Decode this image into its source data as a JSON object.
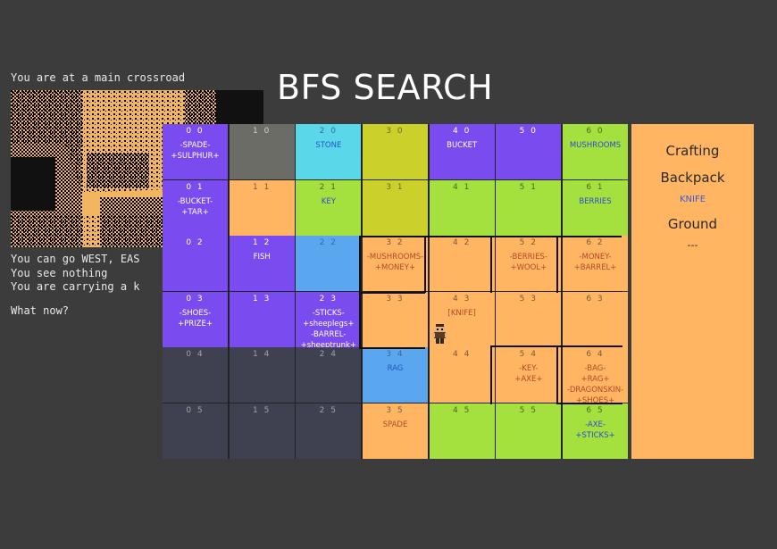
{
  "terminal": {
    "location": "You are at a main crossroad",
    "exits": "You can go WEST, EAS",
    "sees": "You see nothing",
    "carrying": "You are carrying a k",
    "prompt": "What now?"
  },
  "title": "BFS SEARCH",
  "colors": {
    "purple": "#7a4cf0",
    "orange": "#ffb562",
    "green": "#a4e03e",
    "olive": "#cbd02a",
    "cyan": "#5ad8ea",
    "blue": "#5aa7f0",
    "darkslate": "#3f4150",
    "gray": "#6c6c66",
    "wall": "#111111"
  },
  "grid": {
    "cells": [
      {
        "coord": "0 0",
        "lines": [
          "-SPADE-",
          "+SULPHUR+"
        ],
        "color": "purple"
      },
      {
        "coord": "1 0",
        "lines": [],
        "color": "gray"
      },
      {
        "coord": "2 0",
        "lines": [
          "STONE"
        ],
        "color": "cyan"
      },
      {
        "coord": "3 0",
        "lines": [],
        "color": "olive"
      },
      {
        "coord": "4 0",
        "lines": [
          "BUCKET"
        ],
        "color": "purple"
      },
      {
        "coord": "5 0",
        "lines": [],
        "color": "purple"
      },
      {
        "coord": "6 0",
        "lines": [
          "MUSHROOMS"
        ],
        "color": "green"
      },
      {
        "coord": "0 1",
        "lines": [
          "-BUCKET-",
          "+TAR+"
        ],
        "color": "purple"
      },
      {
        "coord": "1 1",
        "lines": [],
        "color": "orange"
      },
      {
        "coord": "2 1",
        "lines": [
          "KEY"
        ],
        "color": "green"
      },
      {
        "coord": "3 1",
        "lines": [],
        "color": "olive"
      },
      {
        "coord": "4 1",
        "lines": [],
        "color": "green"
      },
      {
        "coord": "5 1",
        "lines": [],
        "color": "green"
      },
      {
        "coord": "6 1",
        "lines": [
          "BERRIES"
        ],
        "color": "green"
      },
      {
        "coord": "0 2",
        "lines": [],
        "color": "purple"
      },
      {
        "coord": "1 2",
        "lines": [
          "FISH"
        ],
        "color": "purple"
      },
      {
        "coord": "2 2",
        "lines": [],
        "color": "blue"
      },
      {
        "coord": "3 2",
        "lines": [
          "-MUSHROOMS-",
          "+MONEY+"
        ],
        "color": "orange"
      },
      {
        "coord": "4 2",
        "lines": [],
        "color": "orange"
      },
      {
        "coord": "5 2",
        "lines": [
          "-BERRIES-",
          "+WOOL+"
        ],
        "color": "orange"
      },
      {
        "coord": "6 2",
        "lines": [
          "-MONEY-",
          "+BARREL+"
        ],
        "color": "orange"
      },
      {
        "coord": "0 3",
        "lines": [
          "-SHOES-",
          "+PRIZE+"
        ],
        "color": "purple"
      },
      {
        "coord": "1 3",
        "lines": [],
        "color": "purple"
      },
      {
        "coord": "2 3",
        "lines": [
          "-STICKS-",
          "+sheeplegs+",
          "-BARREL-",
          "+sheeptrunk+"
        ],
        "color": "purple"
      },
      {
        "coord": "3 3",
        "lines": [],
        "color": "orange"
      },
      {
        "coord": "4 3",
        "lines": [
          "[KNIFE]"
        ],
        "color": "orange"
      },
      {
        "coord": "5 3",
        "lines": [],
        "color": "orange"
      },
      {
        "coord": "6 3",
        "lines": [],
        "color": "orange"
      },
      {
        "coord": "0 4",
        "lines": [],
        "color": "darkslate"
      },
      {
        "coord": "1 4",
        "lines": [],
        "color": "darkslate"
      },
      {
        "coord": "2 4",
        "lines": [],
        "color": "darkslate"
      },
      {
        "coord": "3 4",
        "lines": [
          "RAG"
        ],
        "color": "blue"
      },
      {
        "coord": "4 4",
        "lines": [],
        "color": "orange"
      },
      {
        "coord": "5 4",
        "lines": [
          "-KEY-",
          "+AXE+"
        ],
        "color": "orange"
      },
      {
        "coord": "6 4",
        "lines": [
          "-BAG-",
          "+RAG+",
          "-DRAGONSKIN-",
          "+SHOES+"
        ],
        "color": "orange"
      },
      {
        "coord": "0 5",
        "lines": [],
        "color": "darkslate"
      },
      {
        "coord": "1 5",
        "lines": [],
        "color": "darkslate"
      },
      {
        "coord": "2 5",
        "lines": [],
        "color": "darkslate"
      },
      {
        "coord": "3 5",
        "lines": [
          "SPADE"
        ],
        "color": "orange"
      },
      {
        "coord": "4 5",
        "lines": [],
        "color": "green"
      },
      {
        "coord": "5 5",
        "lines": [],
        "color": "green"
      },
      {
        "coord": "6 5",
        "lines": [
          "-AXE-",
          "+STICKS+"
        ],
        "color": "green"
      }
    ]
  },
  "panel": {
    "crafting": "Crafting",
    "backpack": "Backpack",
    "backpack_item": "KNIFE",
    "ground": "Ground",
    "ground_item": "---"
  }
}
